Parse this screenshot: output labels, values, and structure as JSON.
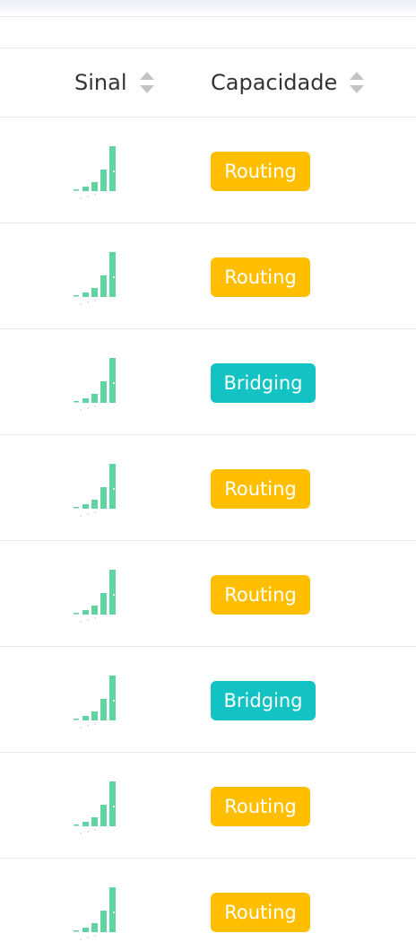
{
  "header": {
    "columns": [
      {
        "label": "Sinal"
      },
      {
        "label": "Capacidade"
      }
    ]
  },
  "colors": {
    "signal_bar": "#5fd3a0",
    "routing": "#ffbf00",
    "bridging": "#13c2c2"
  },
  "rows": [
    {
      "signal_icon": "signal-strength-icon",
      "capacity": "Routing",
      "type": "routing"
    },
    {
      "signal_icon": "signal-strength-icon",
      "capacity": "Routing",
      "type": "routing"
    },
    {
      "signal_icon": "signal-strength-icon",
      "capacity": "Bridging",
      "type": "bridging"
    },
    {
      "signal_icon": "signal-strength-icon",
      "capacity": "Routing",
      "type": "routing"
    },
    {
      "signal_icon": "signal-strength-icon",
      "capacity": "Routing",
      "type": "routing"
    },
    {
      "signal_icon": "signal-strength-icon",
      "capacity": "Bridging",
      "type": "bridging"
    },
    {
      "signal_icon": "signal-strength-icon",
      "capacity": "Routing",
      "type": "routing"
    },
    {
      "signal_icon": "signal-strength-icon",
      "capacity": "Routing",
      "type": "routing"
    }
  ]
}
